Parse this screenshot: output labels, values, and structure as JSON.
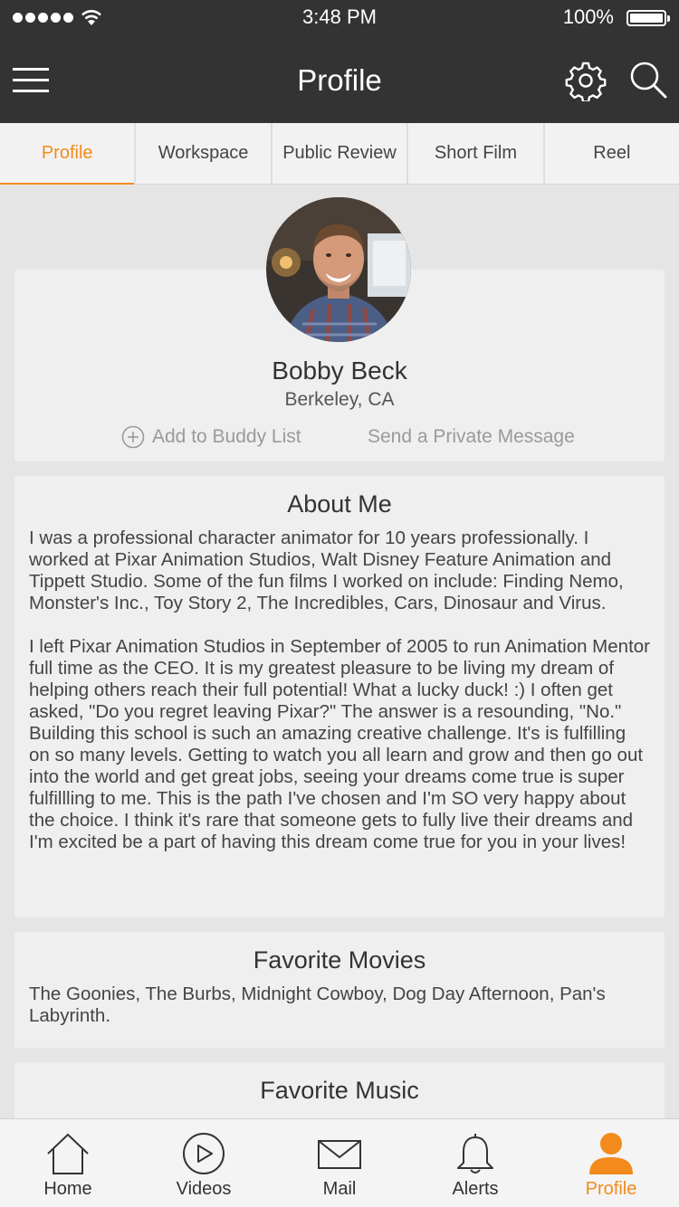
{
  "status_bar": {
    "time": "3:48 PM",
    "battery": "100%"
  },
  "header": {
    "title": "Profile"
  },
  "tabs": [
    {
      "label": "Profile",
      "active": true
    },
    {
      "label": "Workspace",
      "active": false
    },
    {
      "label": "Public Review",
      "active": false
    },
    {
      "label": "Short Film",
      "active": false
    },
    {
      "label": "Reel",
      "active": false
    }
  ],
  "profile": {
    "name": "Bobby Beck",
    "location": "Berkeley, CA",
    "add_buddy_label": "Add to Buddy List",
    "message_label": "Send a Private Message"
  },
  "about": {
    "title": "About Me",
    "paragraphs": [
      "I was a professional character animator for 10 years professionally. I worked at Pixar Animation Studios, Walt Disney Feature Animation and Tippett Studio. Some of the fun films I worked on include: Finding Nemo, Monster's Inc., Toy Story 2, The Incredibles, Cars, Dinosaur and Virus.",
      "I left Pixar Animation Studios in September of 2005 to run Animation Mentor full time as the CEO. It is my greatest pleasure to be living my dream of helping others reach their full potential! What a lucky duck! :) I often get asked, \"Do you regret leaving Pixar?\" The answer is a resounding, \"No.\" Building this school is such an amazing creative challenge. It's is fulfilling on so many levels. Getting to watch you all learn and grow and then go out into the world and get great jobs, seeing your dreams come true is super fulfillling to me. This is the path I've chosen and I'm SO very happy about the choice. I think it's rare that someone gets to fully live their dreams and I'm excited be a part of having this dream come true for you in your lives!"
    ]
  },
  "movies": {
    "title": "Favorite Movies",
    "text": "The Goonies, The Burbs, Midnight Cowboy, Dog Day Afternoon, Pan's Labyrinth."
  },
  "music": {
    "title": "Favorite Music"
  },
  "tabbar": [
    {
      "label": "Home",
      "icon": "home-icon",
      "active": false
    },
    {
      "label": "Videos",
      "icon": "play-icon",
      "active": false
    },
    {
      "label": "Mail",
      "icon": "mail-icon",
      "active": false
    },
    {
      "label": "Alerts",
      "icon": "bell-icon",
      "active": false
    },
    {
      "label": "Profile",
      "icon": "person-icon",
      "active": true
    }
  ],
  "colors": {
    "accent": "#f28b1c",
    "header_bg": "#333333",
    "page_bg": "#e5e5e5"
  }
}
